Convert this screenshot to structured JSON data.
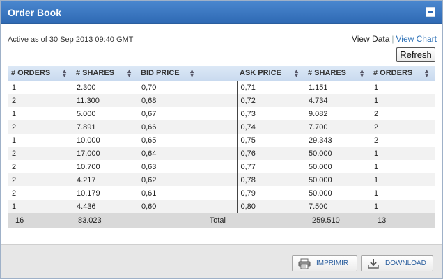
{
  "panel": {
    "title": "Order Book",
    "minimize_icon": "minimize-icon"
  },
  "status": {
    "active_text": "Active as of 30 Sep 2013 09:40 GMT"
  },
  "views": {
    "data_label": "View Data",
    "separator": "|",
    "chart_label": "View Chart"
  },
  "toolbar": {
    "refresh_label": "Refresh"
  },
  "table": {
    "headers": [
      "# ORDERS",
      "# SHARES",
      "BID PRICE",
      "ASK PRICE",
      "# SHARES",
      "# ORDERS"
    ],
    "rows": [
      [
        "1",
        "2.300",
        "0,70",
        "0,71",
        "1.151",
        "1"
      ],
      [
        "2",
        "11.300",
        "0,68",
        "0,72",
        "4.734",
        "1"
      ],
      [
        "1",
        "5.000",
        "0,67",
        "0,73",
        "9.082",
        "2"
      ],
      [
        "2",
        "7.891",
        "0,66",
        "0,74",
        "7.700",
        "2"
      ],
      [
        "1",
        "10.000",
        "0,65",
        "0,75",
        "29.343",
        "2"
      ],
      [
        "2",
        "17.000",
        "0,64",
        "0,76",
        "50.000",
        "1"
      ],
      [
        "2",
        "10.700",
        "0,63",
        "0,77",
        "50.000",
        "1"
      ],
      [
        "2",
        "4.217",
        "0,62",
        "0,78",
        "50.000",
        "1"
      ],
      [
        "2",
        "10.179",
        "0,61",
        "0,79",
        "50.000",
        "1"
      ],
      [
        "1",
        "4.436",
        "0,60",
        "0,80",
        "7.500",
        "1"
      ]
    ],
    "totals": {
      "bid_orders": "16",
      "bid_shares": "83.023",
      "label": "Total",
      "ask_shares": "259.510",
      "ask_orders": "13"
    },
    "sort_icon": "sort-arrows-icon"
  },
  "footer": {
    "print_label": "IMPRIMIR",
    "print_icon": "printer-icon",
    "download_label": "DOWNLOAD",
    "download_icon": "download-icon"
  },
  "colors": {
    "title_bar": "#2f6ab4",
    "header_row": "#c9daef",
    "link": "#2a6fb6"
  }
}
